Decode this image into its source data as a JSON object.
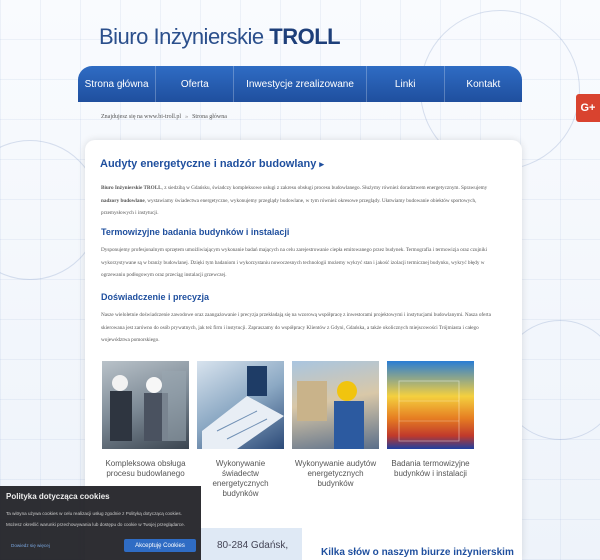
{
  "site": {
    "logo_regular": "Biuro Inżynierskie",
    "logo_bold": "TROLL"
  },
  "nav": {
    "items": [
      {
        "label": "Strona główna"
      },
      {
        "label": "Oferta"
      },
      {
        "label": "Inwestycje zrealizowane"
      },
      {
        "label": "Linki"
      },
      {
        "label": "Kontakt"
      }
    ]
  },
  "breadcrumb": {
    "location": "Znajdujesz się na www.bi-troll.pl",
    "separator": "»",
    "current": "Strona główna"
  },
  "social": {
    "gplus_label": "G+"
  },
  "main": {
    "title": "Audyty energetyczne i nadzór budowlany",
    "title_arrow": "▸",
    "intro_bold1": "Biuro Inżynierskie TROLL",
    "intro_p1": ", z siedzibą w Gdańsku, świadczy kompleksowe usługi z zakresu obsługi procesu budowlanego. Służymy również doradztwem energetycznym. Sprawujemy ",
    "intro_bold2": "nadzory budowlane",
    "intro_p2": ", wystawiamy świadectwa energetyczne, wykonujemy przeglądy budowlane, w tym również okresowe przeglądy. Ułatwiamy budowanie obiektów sportowych, przemysłowych i instytucji.",
    "section2_title": "Termowizyjne badania budynków i instalacji",
    "section2_text": "Dysponujemy profesjonalnym sprzętem umożliwiającym wykonanie badań mających na celu zarejestrowanie ciepła emitowanego przez budynek. Termografia i termowizja oraz czujniki wykorzystywane są w branży budowlanej. Dzięki tym badaniom i wykorzystaniu nowoczesnych technologii możemy wykryć stan i jakość izolacji termicznej budynku, wykryć błędy w ogrzewaniu podłogowym oraz przeciąg instalacji grzewczej.",
    "section3_title": "Doświadczenie i precyzja",
    "section3_text": "Nasze wieloletnie doświadczenie zawodowe oraz zaangażowanie i precyzja przekładają się na wzorową współpracę z inwestorami projektowymi i instytucjami budowlanymi. Nasza oferta skierowana jest zarówno do osób prywatnych, jak też firm i instytucji. Zapraszamy do współpracy Klientów z Gdyni, Gdańska, a także okolicznych miejscowości Trójmiasta i całego województwa pomorskiego."
  },
  "cards": [
    {
      "caption": "Kompleksowa obsługa procesu budowlanego"
    },
    {
      "caption": "Wykonywanie świadectw energetycznych budynków"
    },
    {
      "caption": "Wykonywanie audytów energetycznych budynków"
    },
    {
      "caption": "Badania termowizyjne budynków i instalacji"
    }
  ],
  "footer": {
    "address": "80-284 Gdańsk,",
    "about_title": "Kilka słów o naszym biurze inżynierskim"
  },
  "cookie": {
    "title": "Polityka dotycząca cookies",
    "line1": "Ta witryna używa cookies w celu realizacji usług zgodnie z Polityką dotyczącą cookies.",
    "line2": "Możesz określić warunki przechowywania lub dostępu do cookie w Twojej przeglądarce.",
    "link": "Dowiedz się więcej",
    "accept": "Akceptuję Cookies"
  }
}
